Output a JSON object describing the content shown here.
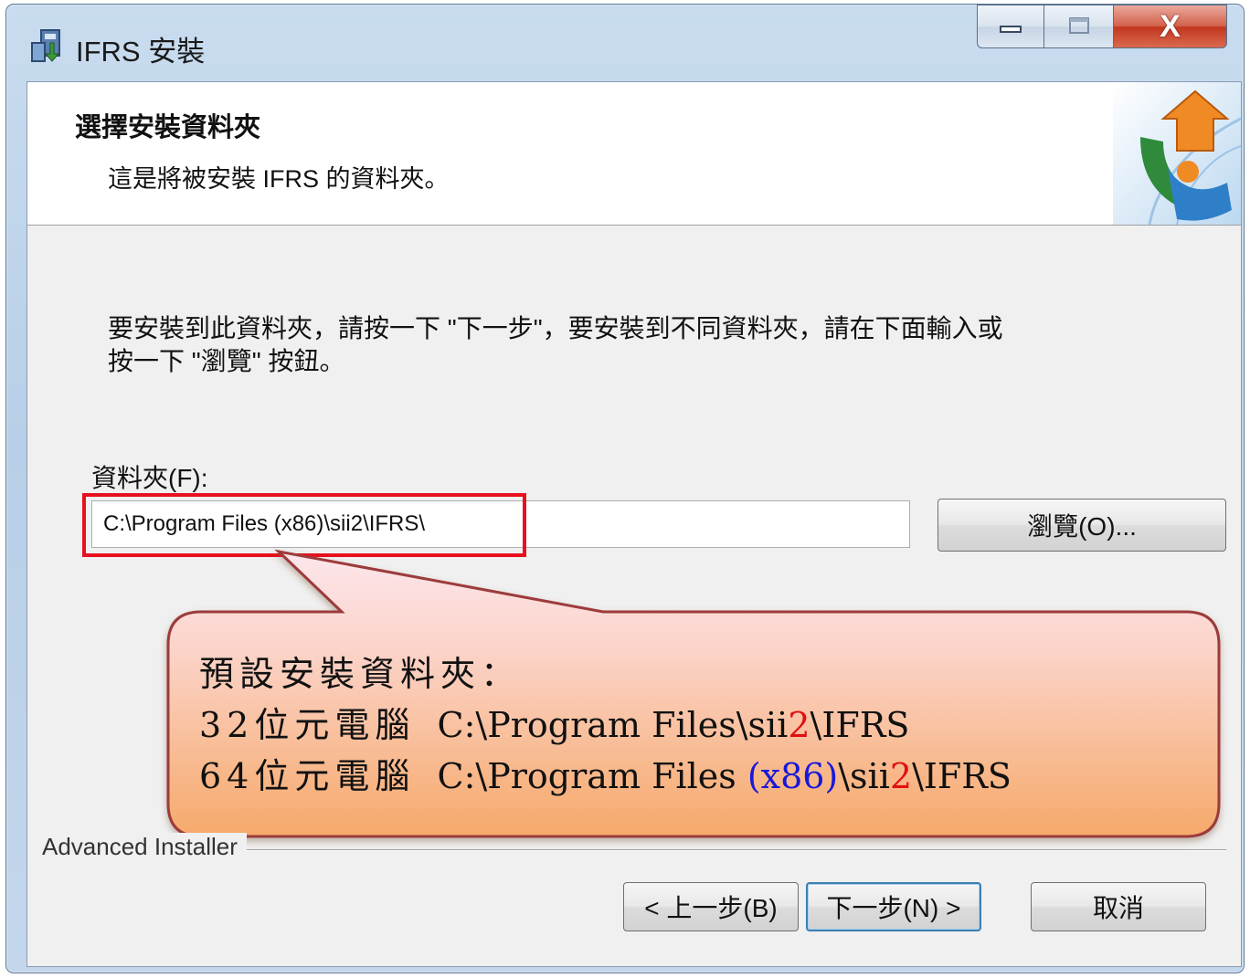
{
  "window": {
    "title": "IFRS 安裝",
    "minimize_icon": "minimize-icon",
    "maximize_icon": "maximize-icon",
    "close_label": "X"
  },
  "banner": {
    "title": "選擇安裝資料夾",
    "subtitle": "這是將被安裝 IFRS 的資料夾。",
    "logo_icon": "installer-puzzle-logo"
  },
  "instruction": {
    "line1": "要安裝到此資料夾，請按一下 \"下一步\"，要安裝到不同資料夾，請在下面輸入或",
    "line2": "按一下 \"瀏覽\" 按鈕。"
  },
  "folder": {
    "label": "資料夾(F):",
    "value": "C:\\Program Files (x86)\\sii2\\IFRS\\"
  },
  "browse_button": "瀏覽(O)...",
  "callout": {
    "heading": "預設安裝資料夾：",
    "line32_prefix": "32位元電腦",
    "line32_path_a": "  C:\\Program Files\\sii",
    "line32_path_red": "2",
    "line32_path_b": "\\IFRS",
    "line64_prefix": "64位元電腦",
    "line64_path_a": "  C:\\Program Files ",
    "line64_path_blue": "(x86)",
    "line64_path_c": "\\sii",
    "line64_path_red": "2",
    "line64_path_d": "\\IFRS"
  },
  "brand": "Advanced Installer",
  "buttons": {
    "back": "< 上一步(B)",
    "next": "下一步(N) >",
    "cancel": "取消"
  },
  "colors": {
    "highlight_border": "#e8101c",
    "callout_top": "#fde6ec",
    "callout_bottom": "#f6a96a",
    "callout_border": "#9c3a3a"
  }
}
